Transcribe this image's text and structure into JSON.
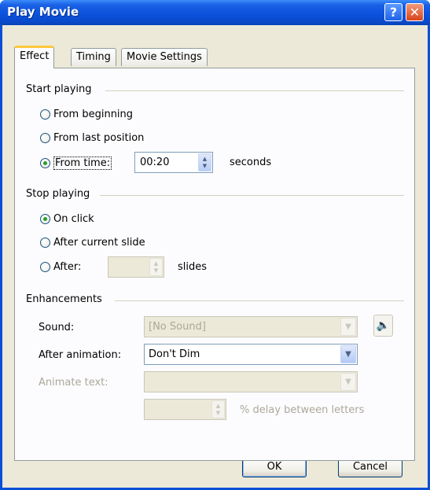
{
  "window": {
    "title": "Play Movie",
    "help_label": "?",
    "close_label": "✕"
  },
  "tabs": [
    {
      "label": "Effect",
      "active": true
    },
    {
      "label": "Timing",
      "active": false
    },
    {
      "label": "Movie Settings",
      "active": false
    }
  ],
  "start_playing": {
    "heading": "Start playing",
    "options": [
      {
        "label": "From beginning",
        "selected": false
      },
      {
        "label": "From last position",
        "selected": false
      },
      {
        "label": "From time:",
        "selected": true
      }
    ],
    "time_value": "00:20",
    "time_unit": "seconds"
  },
  "stop_playing": {
    "heading": "Stop playing",
    "options": [
      {
        "label": "On click",
        "selected": true
      },
      {
        "label": "After current slide",
        "selected": false
      },
      {
        "label": "After:",
        "selected": false
      }
    ],
    "slides_value": "",
    "slides_unit": "slides"
  },
  "enhancements": {
    "heading": "Enhancements",
    "sound_label": "Sound:",
    "sound_value": "[No Sound]",
    "after_animation_label": "After animation:",
    "after_animation_value": "Don't Dim",
    "animate_text_label": "Animate text:",
    "animate_text_value": "",
    "delay_value": "",
    "delay_label": "% delay between letters"
  },
  "buttons": {
    "ok": "OK",
    "cancel": "Cancel"
  },
  "icons": {
    "speaker": "speaker-icon",
    "dropdown": "chevron-down-icon",
    "spin": "spin-arrows-icon"
  },
  "colors": {
    "titlebar": "#0b52dc",
    "dialog_bg": "#ece9d8",
    "tab_highlight": "#ffc83c",
    "radio_dot": "#21a121"
  }
}
